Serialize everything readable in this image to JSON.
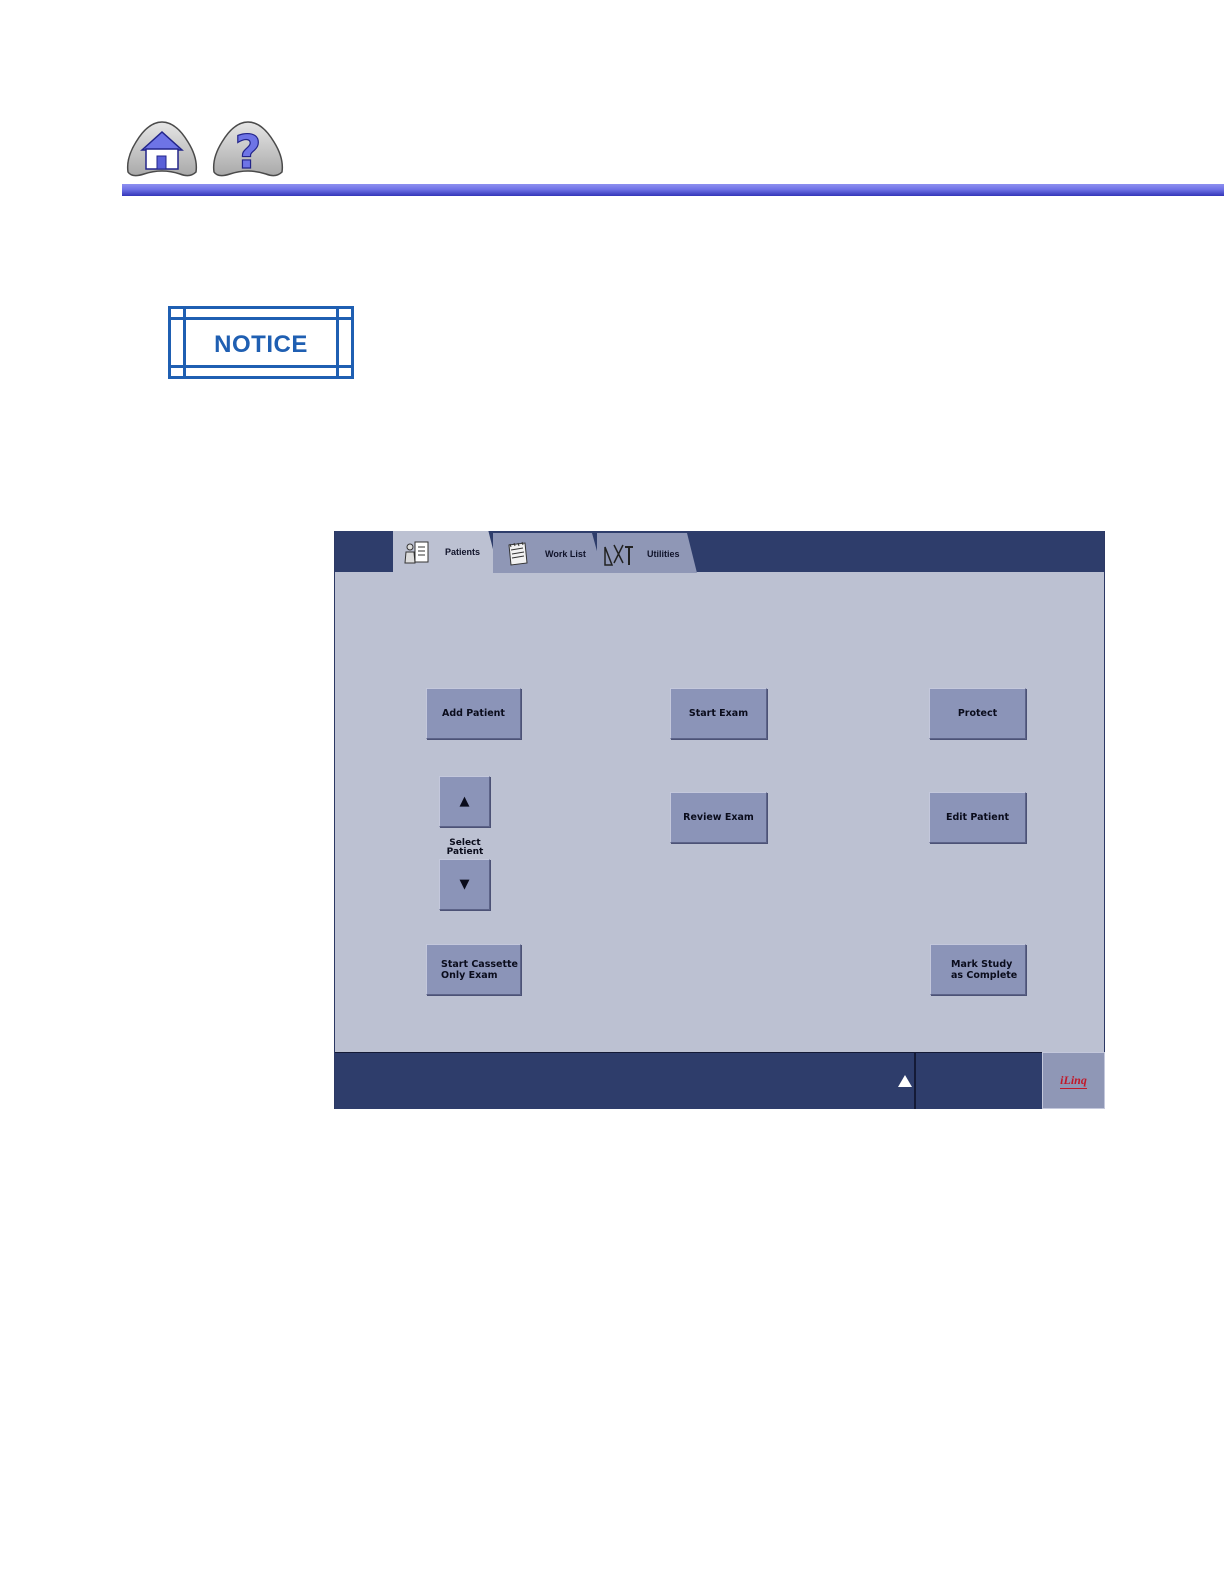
{
  "nav": {
    "home_icon": "home-icon",
    "help_icon": "question-mark-icon"
  },
  "notice": {
    "label": "NOTICE"
  },
  "tabs": [
    {
      "label": "Patients",
      "icon": "patient-clipboard-icon",
      "active": true
    },
    {
      "label": "Work List",
      "icon": "notepad-icon",
      "active": false
    },
    {
      "label": "Utilities",
      "icon": "tools-icon",
      "active": false
    }
  ],
  "buttons": {
    "add_patient": "Add Patient",
    "start_exam": "Start Exam",
    "protect": "Protect",
    "select_up": "▲",
    "select_down": "▼",
    "select_label": "Select\nPatient",
    "review_exam": "Review Exam",
    "edit_patient": "Edit Patient",
    "start_cassette": "Start Cassette\nOnly Exam",
    "mark_complete": "Mark Study\nas Complete"
  },
  "bottom": {
    "expand_icon": "triangle-up-icon",
    "logo": "iLinq"
  },
  "colors": {
    "header_blue": "#6f72e6",
    "notice_blue": "#1f5fb2",
    "bar_navy": "#2e3d6b",
    "panel_gray": "#bcc1d2",
    "button_gray": "#8b94b8",
    "logo_red": "#c0192a"
  }
}
